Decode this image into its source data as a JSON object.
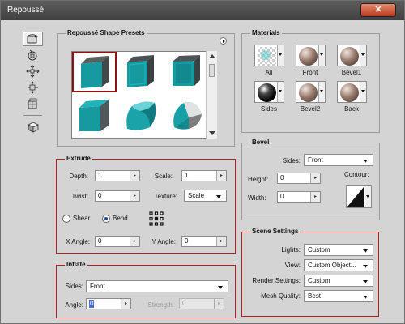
{
  "window": {
    "title": "Repoussé",
    "close_label": "✕"
  },
  "toolbar": [
    {
      "name": "rotate-tool",
      "active": true
    },
    {
      "name": "roll-tool",
      "active": false
    },
    {
      "name": "drag-tool",
      "active": false
    },
    {
      "name": "slide-tool",
      "active": false
    },
    {
      "name": "scale-tool",
      "active": false
    },
    {
      "name": "camera-tool",
      "active": false
    }
  ],
  "presets": {
    "legend": "Repoussé Shape Presets",
    "selected_index": 0
  },
  "extrude": {
    "legend": "Extrude",
    "depth_label": "Depth:",
    "depth_value": "1",
    "scale_label": "Scale:",
    "scale_value": "1",
    "twist_label": "Twist:",
    "twist_value": "0",
    "texture_label": "Texture:",
    "texture_value": "Scale",
    "shear_label": "Shear",
    "bend_label": "Bend",
    "selected_mode": "Bend",
    "x_angle_label": "X Angle:",
    "x_angle_value": "0",
    "y_angle_label": "Y Angle:",
    "y_angle_value": "0"
  },
  "inflate": {
    "legend": "Inflate",
    "sides_label": "Sides:",
    "sides_value": "Front",
    "angle_label": "Angle:",
    "angle_value": "0",
    "strength_label": "Strength:",
    "strength_value": "0"
  },
  "materials": {
    "legend": "Materials",
    "slots": [
      {
        "label": "All",
        "swatch": "checker-swatch"
      },
      {
        "label": "Front",
        "swatch": "wood-swatch"
      },
      {
        "label": "Bevel1",
        "swatch": "wood-swatch"
      },
      {
        "label": "Sides",
        "swatch": "black-swatch"
      },
      {
        "label": "Bevel2",
        "swatch": "wood-swatch"
      },
      {
        "label": "Back",
        "swatch": "wood-swatch"
      }
    ]
  },
  "bevel": {
    "legend": "Bevel",
    "sides_label": "Sides:",
    "sides_value": "Front",
    "height_label": "Height:",
    "height_value": "0",
    "width_label": "Width:",
    "width_value": "0",
    "contour_label": "Contour:"
  },
  "scene": {
    "legend": "Scene Settings",
    "lights_label": "Lights:",
    "lights_value": "Custom",
    "view_label": "View:",
    "view_value": "Custom Object...",
    "render_label": "Render Settings:",
    "render_value": "Custom",
    "mesh_label": "Mesh Quality:",
    "mesh_value": "Best"
  },
  "colors": {
    "selection_border": "#8e1414",
    "highlight_box": "#b01f1f",
    "preset_teal": "#1ea3a8"
  }
}
